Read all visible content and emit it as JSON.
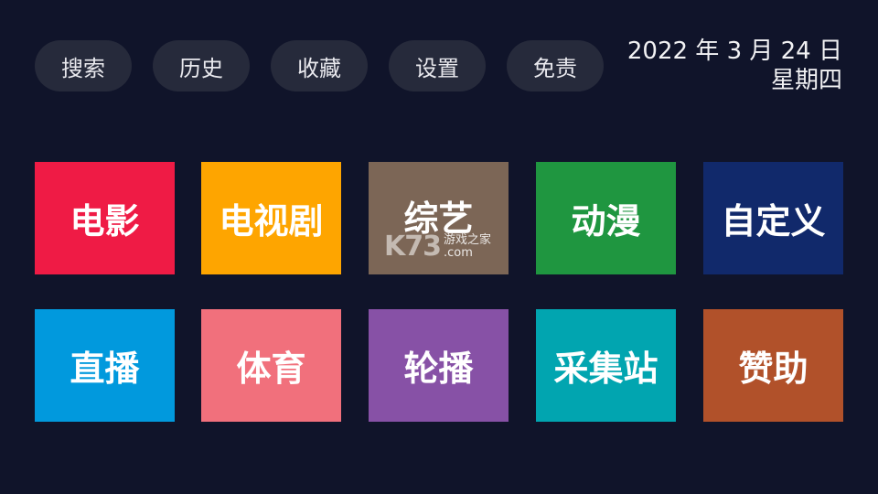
{
  "nav": {
    "search": "搜索",
    "history": "历史",
    "favorites": "收藏",
    "settings": "设置",
    "disclaimer": "免责"
  },
  "datetime": {
    "date": "2022 年 3 月 24 日",
    "weekday": "星期四"
  },
  "tiles": [
    {
      "label": "电影",
      "color": "#ef1b45"
    },
    {
      "label": "电视剧",
      "color": "#fea500"
    },
    {
      "label": "综艺",
      "color": "#7c6656"
    },
    {
      "label": "动漫",
      "color": "#1f9640"
    },
    {
      "label": "自定义",
      "color": "#11296b"
    },
    {
      "label": "直播",
      "color": "#0199dd"
    },
    {
      "label": "体育",
      "color": "#f1707c"
    },
    {
      "label": "轮播",
      "color": "#8751a6"
    },
    {
      "label": "采集站",
      "color": "#01a5b0"
    },
    {
      "label": "赞助",
      "color": "#b1512a"
    }
  ],
  "watermark": {
    "logo": "K73",
    "text": "游戏之家",
    "domain": ".com"
  },
  "colors": {
    "background": "#10142a",
    "pill": "#262a3b"
  }
}
